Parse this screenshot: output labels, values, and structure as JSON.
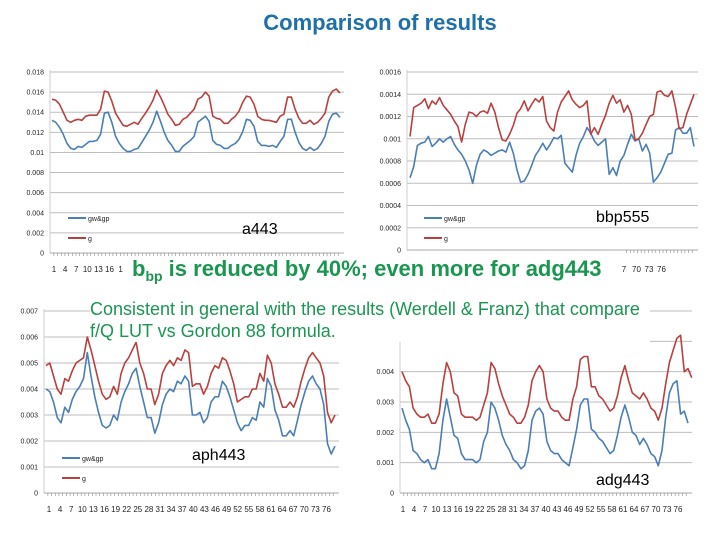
{
  "title": "Comparison of results",
  "headline": {
    "b": "b",
    "sub": "bp",
    "rest": " is reduced by 40%; even more for adg443"
  },
  "body_text": "Consistent in general with the results (Werdell & Franz) that compare f/Q LUT vs Gordon 88 formula.",
  "colors": {
    "title": "#1f6fa8",
    "text_green": "#1a9650",
    "series_blue": "#4a7eb5",
    "series_red": "#b8413f",
    "grid": "#bdbdbd"
  },
  "chart_data": [
    {
      "type": "line",
      "label": "a443",
      "legend": [
        "gw&gp",
        "g"
      ],
      "yticks": [
        "0",
        "0.002",
        "0.004",
        "0.006",
        "0.008",
        "0.01",
        "0.012",
        "0.014",
        "0.016",
        "0.018"
      ],
      "ylim": [
        0,
        0.018
      ],
      "xticks": [
        "1",
        "4",
        "7",
        "10",
        "13",
        "16",
        "1"
      ],
      "grid": true,
      "legend_position": "bottom-left",
      "series": [
        {
          "name": "gw&gp",
          "values": [
            0.0132,
            0.013,
            0.0125,
            0.0118,
            0.0109,
            0.0104,
            0.0103,
            0.0106,
            0.0105,
            0.0108,
            0.0111,
            0.0111,
            0.0112,
            0.0118,
            0.0139,
            0.014,
            0.013,
            0.0116,
            0.0109,
            0.0104,
            0.0101,
            0.0101,
            0.0103,
            0.0104,
            0.011,
            0.0116,
            0.0122,
            0.013,
            0.0141,
            0.0131,
            0.012,
            0.0112,
            0.0107,
            0.0101,
            0.0101,
            0.0106,
            0.0109,
            0.0112,
            0.0116,
            0.013,
            0.0133,
            0.0136,
            0.0131,
            0.0112,
            0.0108,
            0.0107,
            0.0104,
            0.0104,
            0.0107,
            0.0109,
            0.0113,
            0.0121,
            0.0133,
            0.0132,
            0.0126,
            0.0111,
            0.0107,
            0.0107,
            0.0106,
            0.0107,
            0.0105,
            0.0111,
            0.0116,
            0.0133,
            0.0133,
            0.012,
            0.011,
            0.0104,
            0.0102,
            0.0105,
            0.0102,
            0.0104,
            0.0109,
            0.0116,
            0.0131,
            0.0138,
            0.0139,
            0.0135
          ]
        },
        {
          "name": "g",
          "values": [
            0.0153,
            0.0152,
            0.0148,
            0.014,
            0.0132,
            0.013,
            0.0132,
            0.0133,
            0.0132,
            0.0136,
            0.0137,
            0.0137,
            0.0137,
            0.0143,
            0.0161,
            0.016,
            0.0151,
            0.0139,
            0.0133,
            0.0127,
            0.0126,
            0.0128,
            0.013,
            0.0128,
            0.0134,
            0.0139,
            0.0145,
            0.0152,
            0.0162,
            0.0155,
            0.0147,
            0.0138,
            0.0133,
            0.0127,
            0.0128,
            0.0133,
            0.0135,
            0.0139,
            0.0143,
            0.0153,
            0.0155,
            0.016,
            0.0156,
            0.0136,
            0.0134,
            0.0133,
            0.0129,
            0.0129,
            0.0133,
            0.0136,
            0.0141,
            0.015,
            0.0156,
            0.0155,
            0.0148,
            0.0136,
            0.0133,
            0.0132,
            0.0132,
            0.0131,
            0.013,
            0.0136,
            0.0138,
            0.0155,
            0.0155,
            0.0143,
            0.0134,
            0.0129,
            0.0129,
            0.0132,
            0.0128,
            0.013,
            0.0134,
            0.0139,
            0.0155,
            0.0161,
            0.0163,
            0.0159
          ]
        }
      ]
    },
    {
      "type": "line",
      "label": "bbp555",
      "legend": [
        "gw&gp",
        "g"
      ],
      "yticks": [
        "0",
        "0.0002",
        "0.0004",
        "0.0006",
        "0.0008",
        "0.001",
        "0.0012",
        "0.0014",
        "0.0016"
      ],
      "ylim": [
        0,
        0.0016
      ],
      "xticks": [
        "7",
        "70",
        "73",
        "76"
      ],
      "grid": true,
      "legend_position": "bottom-left",
      "series": [
        {
          "name": "gw&gp",
          "values": [
            0.00065,
            0.00075,
            0.00094,
            0.00096,
            0.00097,
            0.00102,
            0.00093,
            0.00096,
            0.001,
            0.00097,
            0.001,
            0.00102,
            0.00095,
            0.0009,
            0.00086,
            0.0008,
            0.00072,
            0.0006,
            0.00076,
            0.00086,
            0.0009,
            0.00088,
            0.00085,
            0.00087,
            0.00089,
            0.0009,
            0.00088,
            0.00097,
            0.00087,
            0.00072,
            0.00061,
            0.00062,
            0.00068,
            0.00076,
            0.00085,
            0.0009,
            0.00096,
            0.0009,
            0.00095,
            0.00101,
            0.001,
            0.00103,
            0.00078,
            0.00074,
            0.0007,
            0.00085,
            0.00096,
            0.00102,
            0.0011,
            0.00105,
            0.00098,
            0.00094,
            0.00097,
            0.001,
            0.00068,
            0.00074,
            0.00067,
            0.0008,
            0.00085,
            0.00095,
            0.00104,
            0.00098,
            0.001,
            0.00089,
            0.00095,
            0.00087,
            0.00061,
            0.00065,
            0.0007,
            0.00078,
            0.00086,
            0.00087,
            0.00108,
            0.0011,
            0.00105,
            0.00105,
            0.0011,
            0.00093
          ]
        },
        {
          "name": "g",
          "values": [
            0.00102,
            0.00128,
            0.0013,
            0.00132,
            0.00136,
            0.00127,
            0.00134,
            0.00131,
            0.00137,
            0.0013,
            0.00126,
            0.00122,
            0.00116,
            0.00111,
            0.00097,
            0.00113,
            0.00124,
            0.00123,
            0.0012,
            0.00124,
            0.00125,
            0.00123,
            0.00132,
            0.00124,
            0.0011,
            0.00099,
            0.00098,
            0.00104,
            0.00112,
            0.00123,
            0.00127,
            0.00134,
            0.00125,
            0.00131,
            0.00136,
            0.00133,
            0.00138,
            0.00116,
            0.0011,
            0.00107,
            0.00124,
            0.00133,
            0.00138,
            0.00143,
            0.00135,
            0.00131,
            0.00128,
            0.0013,
            0.00134,
            0.00104,
            0.0011,
            0.00104,
            0.00113,
            0.00121,
            0.00132,
            0.00139,
            0.00132,
            0.00135,
            0.00124,
            0.0013,
            0.00122,
            0.00099,
            0.001,
            0.00105,
            0.00113,
            0.0012,
            0.00122,
            0.00142,
            0.00143,
            0.00139,
            0.00138,
            0.00143,
            0.00128,
            0.00109,
            0.0011,
            0.00122,
            0.00131,
            0.0014
          ]
        }
      ]
    },
    {
      "type": "line",
      "label": "aph443",
      "legend": [
        "gw&gp",
        "g"
      ],
      "yticks": [
        "0",
        "0.001",
        "0.002",
        "0.003",
        "0.004",
        "0.005",
        "0.006",
        "0.007"
      ],
      "ylim": [
        0,
        0.007
      ],
      "xticks": [
        "1",
        "4",
        "7",
        "10",
        "13",
        "16",
        "19",
        "22",
        "25",
        "28",
        "31",
        "34",
        "37",
        "40",
        "43",
        "46",
        "49",
        "52",
        "55",
        "58",
        "61",
        "64",
        "67",
        "70",
        "73",
        "76"
      ],
      "grid": true,
      "legend_position": "bottom-left",
      "series": [
        {
          "name": "gw&gp",
          "values": [
            0.004,
            0.0039,
            0.0035,
            0.0029,
            0.0027,
            0.0033,
            0.0031,
            0.0036,
            0.0039,
            0.0041,
            0.0044,
            0.0054,
            0.0045,
            0.0037,
            0.0031,
            0.0026,
            0.0025,
            0.0026,
            0.003,
            0.0028,
            0.0035,
            0.0039,
            0.0042,
            0.0046,
            0.0048,
            0.0041,
            0.0035,
            0.0029,
            0.0029,
            0.0023,
            0.0027,
            0.0034,
            0.0038,
            0.004,
            0.0039,
            0.0043,
            0.0042,
            0.0045,
            0.0043,
            0.003,
            0.003,
            0.0031,
            0.0027,
            0.0029,
            0.0035,
            0.0037,
            0.0037,
            0.0043,
            0.0041,
            0.0037,
            0.0032,
            0.0027,
            0.0024,
            0.0026,
            0.0026,
            0.0029,
            0.0028,
            0.0035,
            0.0033,
            0.0044,
            0.0041,
            0.0032,
            0.0028,
            0.0022,
            0.0022,
            0.0024,
            0.0022,
            0.0028,
            0.0034,
            0.0039,
            0.0043,
            0.0045,
            0.0042,
            0.004,
            0.0034,
            0.0019,
            0.0015,
            0.0018
          ]
        },
        {
          "name": "g",
          "values": [
            0.0049,
            0.005,
            0.0045,
            0.004,
            0.0038,
            0.0044,
            0.0043,
            0.0047,
            0.005,
            0.0051,
            0.0052,
            0.006,
            0.0055,
            0.0049,
            0.0043,
            0.0038,
            0.0036,
            0.0037,
            0.0041,
            0.0038,
            0.0046,
            0.005,
            0.0052,
            0.0055,
            0.0058,
            0.005,
            0.0046,
            0.004,
            0.004,
            0.0034,
            0.0038,
            0.0046,
            0.0049,
            0.0051,
            0.0049,
            0.0052,
            0.0051,
            0.0055,
            0.0054,
            0.0041,
            0.0042,
            0.0042,
            0.0038,
            0.0041,
            0.0046,
            0.0049,
            0.0048,
            0.0052,
            0.0051,
            0.0047,
            0.0042,
            0.0035,
            0.0036,
            0.0037,
            0.0037,
            0.004,
            0.004,
            0.0046,
            0.0043,
            0.0053,
            0.005,
            0.0042,
            0.0038,
            0.0033,
            0.0033,
            0.0035,
            0.0033,
            0.0037,
            0.0043,
            0.0048,
            0.0052,
            0.0054,
            0.0052,
            0.005,
            0.0045,
            0.0031,
            0.0027,
            0.003
          ]
        }
      ]
    },
    {
      "type": "line",
      "label": "adg443",
      "legend": [],
      "yticks": [
        "0",
        "0.001",
        "0.002",
        "0.003",
        "0.004"
      ],
      "ylim": [
        0,
        0.006
      ],
      "xticks": [
        "1",
        "4",
        "7",
        "10",
        "13",
        "16",
        "19",
        "22",
        "25",
        "28",
        "31",
        "34",
        "37",
        "40",
        "43",
        "46",
        "49",
        "52",
        "55",
        "58",
        "61",
        "64",
        "67",
        "70",
        "73",
        "76"
      ],
      "grid": true,
      "legend_position": "none",
      "series": [
        {
          "name": "gw&gp",
          "values": [
            0.0028,
            0.0024,
            0.0021,
            0.0014,
            0.0013,
            0.0011,
            0.001,
            0.0011,
            0.0008,
            0.0008,
            0.0013,
            0.0024,
            0.0031,
            0.0025,
            0.0019,
            0.0018,
            0.0013,
            0.0011,
            0.0011,
            0.0011,
            0.001,
            0.0011,
            0.0017,
            0.002,
            0.003,
            0.0028,
            0.0024,
            0.0019,
            0.0016,
            0.0014,
            0.0011,
            0.001,
            0.0008,
            0.0009,
            0.0014,
            0.0024,
            0.0027,
            0.0028,
            0.0026,
            0.0017,
            0.0014,
            0.0013,
            0.0013,
            0.0011,
            0.001,
            0.0009,
            0.0015,
            0.0021,
            0.0029,
            0.0031,
            0.0031,
            0.0021,
            0.002,
            0.0018,
            0.0017,
            0.0015,
            0.0013,
            0.0014,
            0.0019,
            0.0025,
            0.0029,
            0.0025,
            0.002,
            0.0019,
            0.0016,
            0.0018,
            0.0016,
            0.0013,
            0.0012,
            0.0009,
            0.0014,
            0.0025,
            0.0033,
            0.0036,
            0.0037,
            0.0026,
            0.0027,
            0.0023
          ]
        },
        {
          "name": "g",
          "values": [
            0.004,
            0.0037,
            0.0035,
            0.0028,
            0.0026,
            0.0025,
            0.0025,
            0.0026,
            0.0023,
            0.0023,
            0.0026,
            0.0036,
            0.0043,
            0.004,
            0.0033,
            0.0032,
            0.0026,
            0.0025,
            0.0025,
            0.0025,
            0.0024,
            0.0025,
            0.0029,
            0.0033,
            0.0043,
            0.0041,
            0.0036,
            0.0032,
            0.0029,
            0.0026,
            0.0025,
            0.0023,
            0.0023,
            0.0025,
            0.0029,
            0.0037,
            0.004,
            0.0042,
            0.004,
            0.0031,
            0.0028,
            0.0027,
            0.0027,
            0.0025,
            0.0024,
            0.0024,
            0.0031,
            0.0035,
            0.0044,
            0.0045,
            0.0045,
            0.0035,
            0.0035,
            0.0032,
            0.0031,
            0.0029,
            0.0027,
            0.0028,
            0.0032,
            0.0038,
            0.0042,
            0.0037,
            0.0033,
            0.0032,
            0.0031,
            0.0033,
            0.0031,
            0.0028,
            0.0027,
            0.0024,
            0.0028,
            0.0036,
            0.0043,
            0.0047,
            0.0051,
            0.0052,
            0.004,
            0.0041,
            0.0038
          ]
        }
      ]
    }
  ]
}
